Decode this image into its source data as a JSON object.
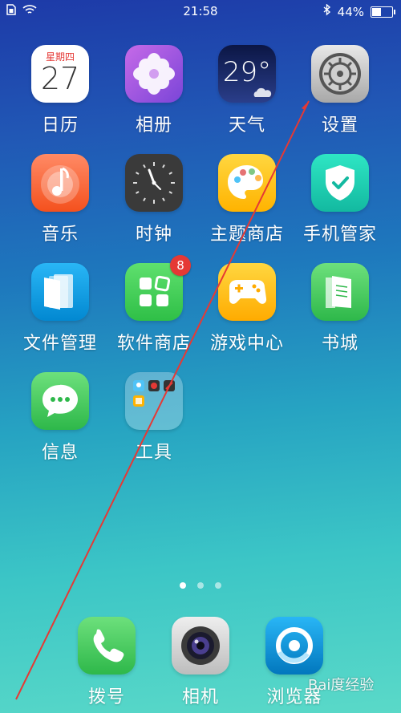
{
  "status_bar": {
    "time": "21:58",
    "battery": "44%",
    "battery_level": 0.44
  },
  "apps": [
    {
      "label": "日历",
      "icon": "calendar-icon",
      "weekday": "星期四",
      "day": "27"
    },
    {
      "label": "相册",
      "icon": "photos-icon"
    },
    {
      "label": "天气",
      "icon": "weather-icon",
      "temp": "29°"
    },
    {
      "label": "设置",
      "icon": "settings-icon"
    },
    {
      "label": "音乐",
      "icon": "music-icon"
    },
    {
      "label": "时钟",
      "icon": "clock-icon"
    },
    {
      "label": "主题商店",
      "icon": "theme-store-icon"
    },
    {
      "label": "手机管家",
      "icon": "phone-manager-icon"
    },
    {
      "label": "文件管理",
      "icon": "file-manager-icon"
    },
    {
      "label": "软件商店",
      "icon": "app-store-icon",
      "badge": "8"
    },
    {
      "label": "游戏中心",
      "icon": "game-center-icon"
    },
    {
      "label": "书城",
      "icon": "bookstore-icon"
    },
    {
      "label": "信息",
      "icon": "messages-icon"
    },
    {
      "label": "工具",
      "icon": "tools-folder-icon"
    }
  ],
  "dock": [
    {
      "label": "拨号",
      "icon": "phone-icon"
    },
    {
      "label": "相机",
      "icon": "camera-icon"
    },
    {
      "label": "浏览器",
      "icon": "browser-icon"
    }
  ],
  "page_indicator": {
    "count": 3,
    "active": 0
  },
  "watermark": "Bai度经验",
  "colors": {
    "annotation_line": "#e53935",
    "badge": "#e53935"
  }
}
